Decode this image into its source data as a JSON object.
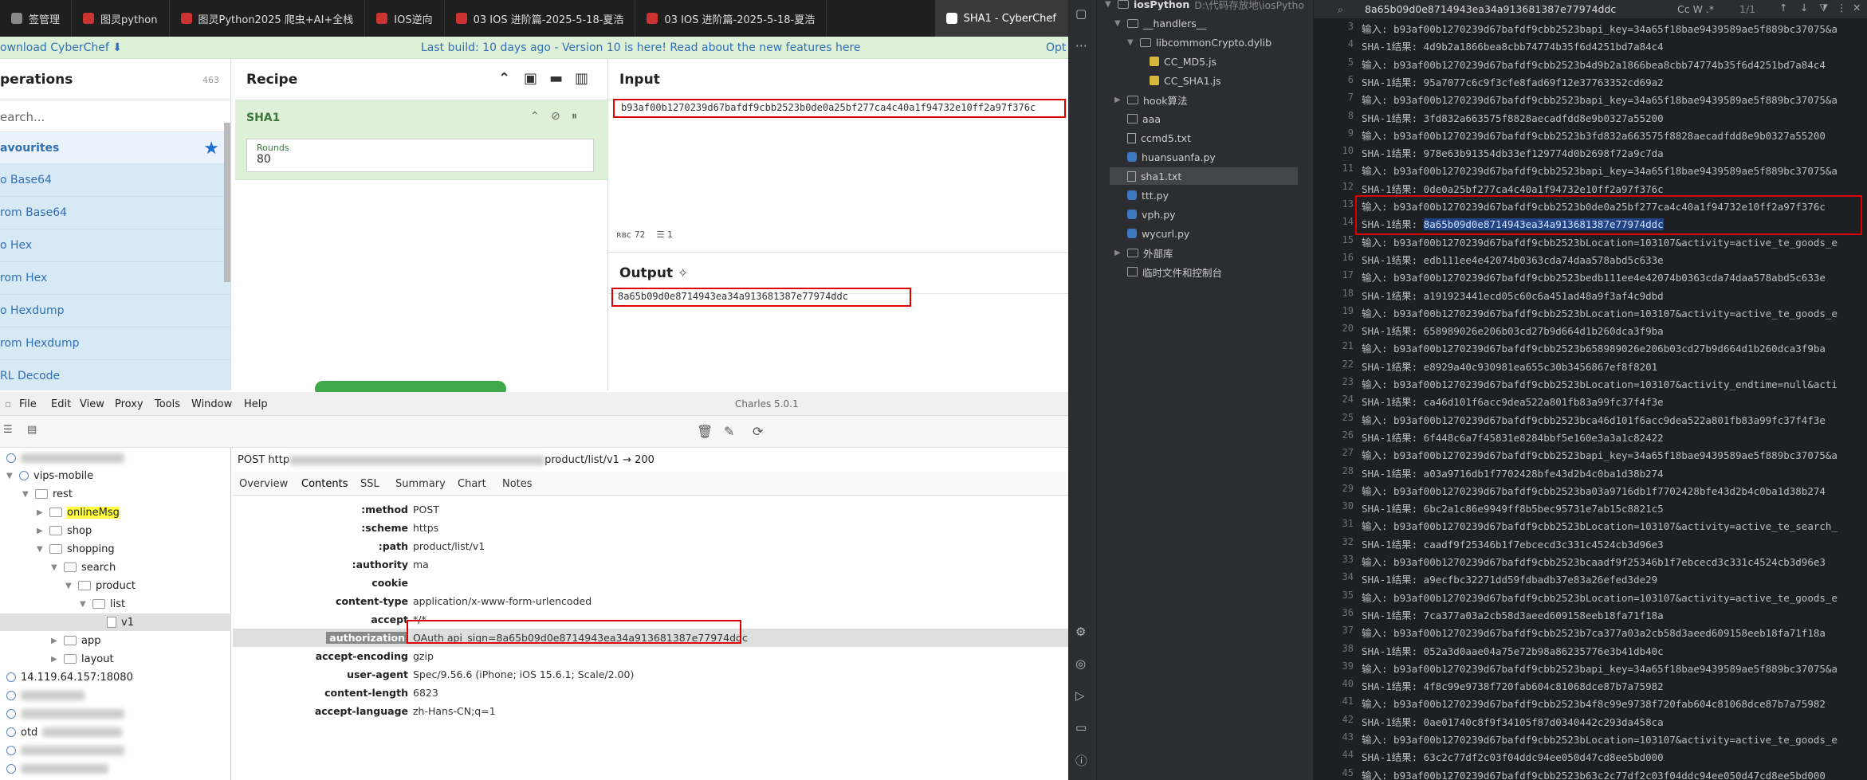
{
  "browser": {
    "tabs": [
      {
        "label": "签管理",
        "color": "#888"
      },
      {
        "label": "图灵python",
        "color": "#c33"
      },
      {
        "label": "图灵Python2025 爬虫+AI+全栈",
        "color": "#c33"
      },
      {
        "label": "IOS逆向",
        "color": "#c33"
      },
      {
        "label": "03 IOS 进阶篇-2025-5-18-夏浩",
        "color": "#c33"
      },
      {
        "label": "03 IOS 进阶篇-2025-5-18-夏浩",
        "color": "#c33"
      },
      {
        "label": "SHA1 - CyberChef",
        "color": "#fff"
      }
    ]
  },
  "cyberchef": {
    "download": "ownload CyberChef",
    "build_notice": "Last build: 10 days ago - Version 10 is here! Read about the new features here",
    "options": "Opt",
    "operations": {
      "title": "perations",
      "count": "463",
      "search_placeholder": "earch...",
      "favourites": "avourites",
      "items": [
        "o Base64",
        "rom Base64",
        "o Hex",
        "rom Hex",
        "o Hexdump",
        "rom Hexdump",
        "RL Decode"
      ]
    },
    "recipe": {
      "title": "Recipe",
      "operation": "SHA1",
      "rounds_label": "Rounds",
      "rounds_value": "80"
    },
    "input": {
      "title": "Input",
      "value": "b93af00b1270239d67bafdf9cbb2523b0de0a25bf277ca4c40a1f94732e10ff2a97f376c",
      "chars": "72",
      "lines": "1"
    },
    "output": {
      "title": "Output",
      "value": "8a65b09d0e8714943ea34a913681387e77974ddc"
    }
  },
  "charles": {
    "menu": [
      "File",
      "Edit",
      "View",
      "Proxy",
      "Tools",
      "Window",
      "Help"
    ],
    "title": "Charles 5.0.1",
    "tree": {
      "host": "vips-mobile",
      "rest": "rest",
      "onlineMsg": "onlineMsg",
      "shop": "shop",
      "shopping": "shopping",
      "search": "search",
      "product": "product",
      "list": "list",
      "v1": "v1",
      "app": "app",
      "layout": "layout",
      "ip": "14.119.64.157:18080",
      "otd": "otd"
    },
    "request": {
      "method_prefix": "POST http",
      "path_suffix": "product/list/v1",
      "status": "→ 200"
    },
    "tabs": [
      "Overview",
      "Contents",
      "SSL",
      "Summary",
      "Chart",
      "Notes"
    ],
    "headers": [
      {
        "k": ":method",
        "v": "POST"
      },
      {
        "k": ":scheme",
        "v": "https"
      },
      {
        "k": ":path",
        "v": "product/list/v1"
      },
      {
        "k": ":authority",
        "v": "ma"
      },
      {
        "k": "cookie",
        "v": ""
      },
      {
        "k": "content-type",
        "v": "application/x-www-form-urlencoded"
      },
      {
        "k": "accept",
        "v": "*/*"
      },
      {
        "k": "authorization",
        "v": "OAuth api_sign=8a65b09d0e8714943ea34a913681387e77974ddc"
      },
      {
        "k": "accept-encoding",
        "v": "gzip"
      },
      {
        "k": "user-agent",
        "v": "Spec/9.56.6 (iPhone; iOS 15.6.1; Scale/2.00)"
      },
      {
        "k": "content-length",
        "v": "6823"
      },
      {
        "k": "accept-language",
        "v": "zh-Hans-CN;q=1"
      }
    ]
  },
  "ide": {
    "project_name": "iosPython",
    "project_path": "D:\\代码存放地\\iosPytho",
    "search_query": "8a65b09d0e8714943ea34a913681387e77974ddc",
    "search_count": "1/1",
    "search_opts": "Cc  W  .*",
    "tree": {
      "handlers": "__handlers__",
      "dylib": "libcommonCrypto.dylib",
      "md5js": "CC_MD5.js",
      "sha1js": "CC_SHA1.js",
      "hook": "hook算法",
      "aaa": "aaa",
      "ccmd5": "ccmd5.txt",
      "huansuanfa": "huansuanfa.py",
      "sha1txt": "sha1.txt",
      "ttt": "ttt.py",
      "vph": "vph.py",
      "wycurl": "wycurl.py",
      "external": "外部库",
      "scratch": "临时文件和控制台"
    },
    "lines": [
      {
        "n": "3",
        "t": "输入: b93af00b1270239d67bafdf9cbb2523bapi_key=34a65f18bae9439589ae5f889bc37075&a"
      },
      {
        "n": "4",
        "t": "SHA-1结果: 4d9b2a1866bea8cbb74774b35f6d4251bd7a84c4"
      },
      {
        "n": "5",
        "t": "输入: b93af00b1270239d67bafdf9cbb2523b4d9b2a1866bea8cbb74774b35f6d4251bd7a84c4"
      },
      {
        "n": "6",
        "t": "SHA-1结果: 95a7077c6c9f3cfe8fad69f12e37763352cd69a2"
      },
      {
        "n": "7",
        "t": "输入: b93af00b1270239d67bafdf9cbb2523bapi_key=34a65f18bae9439589ae5f889bc37075&a"
      },
      {
        "n": "8",
        "t": "SHA-1结果: 3fd832a663575f8828aecadfdd8e9b0327a55200"
      },
      {
        "n": "9",
        "t": "输入: b93af00b1270239d67bafdf9cbb2523b3fd832a663575f8828aecadfdd8e9b0327a55200"
      },
      {
        "n": "10",
        "t": "SHA-1结果: 978e63b91354db33ef129774d0b2698f72a9c7da"
      },
      {
        "n": "11",
        "t": "输入: b93af00b1270239d67bafdf9cbb2523bapi_key=34a65f18bae9439589ae5f889bc37075&a"
      },
      {
        "n": "12",
        "t": "SHA-1结果: 0de0a25bf277ca4c40a1f94732e10ff2a97f376c"
      },
      {
        "n": "13",
        "t": "输入: b93af00b1270239d67bafdf9cbb2523b0de0a25bf277ca4c40a1f94732e10ff2a97f376c"
      },
      {
        "n": "14",
        "t": "SHA-1结果: ",
        "sel": "8a65b09d0e8714943ea34a913681387e77974ddc"
      },
      {
        "n": "15",
        "t": "输入: b93af00b1270239d67bafdf9cbb2523bLocation=103107&activity=active_te_goods_e"
      },
      {
        "n": "16",
        "t": "SHA-1结果: edb111ee4e42074b0363cda74daa578abd5c633e"
      },
      {
        "n": "17",
        "t": "输入: b93af00b1270239d67bafdf9cbb2523bedb111ee4e42074b0363cda74daa578abd5c633e"
      },
      {
        "n": "18",
        "t": "SHA-1结果: a191923441ecd05c60c6a451ad48a9f3af4c9dbd"
      },
      {
        "n": "19",
        "t": "输入: b93af00b1270239d67bafdf9cbb2523bLocation=103107&activity=active_te_goods_e"
      },
      {
        "n": "20",
        "t": "SHA-1结果: 658989026e206b03cd27b9d664d1b260dca3f9ba"
      },
      {
        "n": "21",
        "t": "输入: b93af00b1270239d67bafdf9cbb2523b658989026e206b03cd27b9d664d1b260dca3f9ba"
      },
      {
        "n": "22",
        "t": "SHA-1结果: e8929a40c930981ea655c30b3456867ef8f8201"
      },
      {
        "n": "23",
        "t": "输入: b93af00b1270239d67bafdf9cbb2523bLocation=103107&activity_endtime=null&acti"
      },
      {
        "n": "24",
        "t": "SHA-1结果: ca46d101f6acc9dea522a801fb83a99fc37f4f3e"
      },
      {
        "n": "25",
        "t": "输入: b93af00b1270239d67bafdf9cbb2523bca46d101f6acc9dea522a801fb83a99fc37f4f3e"
      },
      {
        "n": "26",
        "t": "SHA-1结果: 6f448c6a7f45831e8284bbf5e160e3a3a1c82422"
      },
      {
        "n": "27",
        "t": "输入: b93af00b1270239d67bafdf9cbb2523bapi_key=34a65f18bae9439589ae5f889bc37075&a"
      },
      {
        "n": "28",
        "t": "SHA-1结果: a03a9716db1f7702428bfe43d2b4c0ba1d38b274"
      },
      {
        "n": "29",
        "t": "输入: b93af00b1270239d67bafdf9cbb2523ba03a9716db1f7702428bfe43d2b4c0ba1d38b274"
      },
      {
        "n": "30",
        "t": "SHA-1结果: 6bc2a1c86e9949ff8b5bec95731e7ab15c8821c5"
      },
      {
        "n": "31",
        "t": "输入: b93af00b1270239d67bafdf9cbb2523bLocation=103107&activity=active_te_search_"
      },
      {
        "n": "32",
        "t": "SHA-1结果: caadf9f25346b1f7ebcecd3c331c4524cb3d96e3"
      },
      {
        "n": "33",
        "t": "输入: b93af00b1270239d67bafdf9cbb2523bcaadf9f25346b1f7ebcecd3c331c4524cb3d96e3"
      },
      {
        "n": "34",
        "t": "SHA-1结果: a9ecfbc32271dd59fdbadb37e83a26efed3de29"
      },
      {
        "n": "35",
        "t": "输入: b93af00b1270239d67bafdf9cbb2523bLocation=103107&activity=active_te_goods_e"
      },
      {
        "n": "36",
        "t": "SHA-1结果: 7ca377a03a2cb58d3aeed609158eeb18fa71f18a"
      },
      {
        "n": "37",
        "t": "输入: b93af00b1270239d67bafdf9cbb2523b7ca377a03a2cb58d3aeed609158eeb18fa71f18a"
      },
      {
        "n": "38",
        "t": "SHA-1结果: 052a3d0aae04a75e72b98a86235776e3b41db40c"
      },
      {
        "n": "39",
        "t": "输入: b93af00b1270239d67bafdf9cbb2523bapi_key=34a65f18bae9439589ae5f889bc37075&a"
      },
      {
        "n": "40",
        "t": "SHA-1结果: 4f8c99e9738f720fab604c81068dce87b7a75982"
      },
      {
        "n": "41",
        "t": "输入: b93af00b1270239d67bafdf9cbb2523b4f8c99e9738f720fab604c81068dce87b7a75982"
      },
      {
        "n": "42",
        "t": "SHA-1结果: 0ae01740c8f9f34105f87d0340442c293da458ca"
      },
      {
        "n": "43",
        "t": "输入: b93af00b1270239d67bafdf9cbb2523bLocation=103107&activity=active_te_goods_e"
      },
      {
        "n": "44",
        "t": "SHA-1结果: 63c2c77df2c03f04ddc94ee050d47cd8ee5bd000"
      },
      {
        "n": "45",
        "t": "输入: b93af00b1270239d67bafdf9cbb2523b63c2c77df2c03f04ddc94ee050d47cd8ee5bd000"
      }
    ]
  }
}
